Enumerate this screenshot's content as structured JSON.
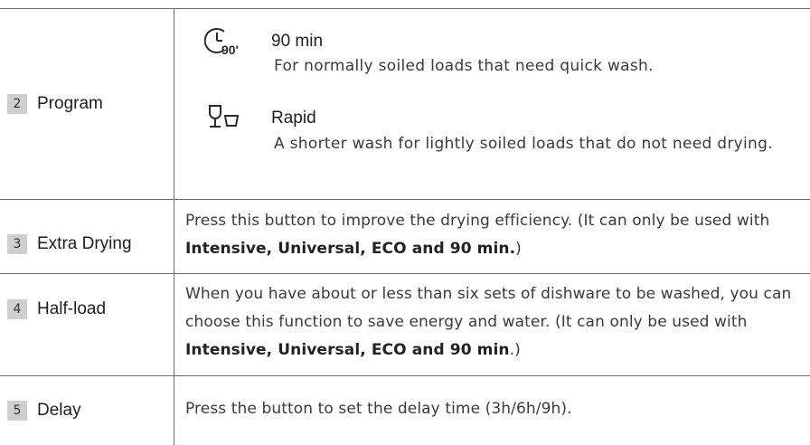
{
  "rows": [
    {
      "number": "2",
      "label": "Program",
      "programs": [
        {
          "icon": "clock-90-icon",
          "icon_text": "90'",
          "title": "90 min",
          "description": "For normally soiled loads that need quick wash."
        },
        {
          "icon": "glass-and-cup-icon",
          "title": "Rapid",
          "description": "A shorter wash for lightly soiled loads that do not need drying."
        }
      ]
    },
    {
      "number": "3",
      "label": "Extra Drying",
      "text": "Press this button to improve the drying efficiency. (It can only be used with ",
      "bold": "Intensive, Universal, ECO and 90 min.",
      "tail": ")"
    },
    {
      "number": "4",
      "label": "Half-load",
      "text": "When you have about or less than six sets of dishware to be washed, you can choose this function to save energy and water. (It can only be used with ",
      "bold": "Intensive, Universal, ECO and 90 min",
      "tail": ".)"
    },
    {
      "number": "5",
      "label": "Delay",
      "text": "Press the button to set the delay time (3h/6h/9h)."
    }
  ],
  "colors": {
    "badge_bg": "#cfcfcf",
    "rule": "#6b6b6b",
    "text": "#3a3a3a"
  }
}
